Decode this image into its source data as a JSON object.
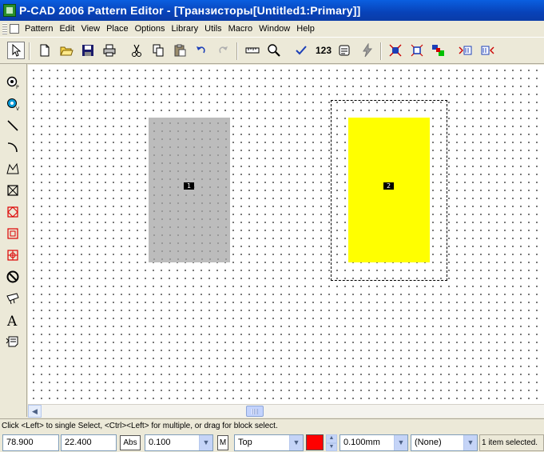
{
  "window": {
    "title": "P-CAD 2006 Pattern Editor - [Транзисторы[Untitled1:Primary]]"
  },
  "menu": {
    "items": [
      {
        "label": "Pattern"
      },
      {
        "label": "Edit"
      },
      {
        "label": "View"
      },
      {
        "label": "Place"
      },
      {
        "label": "Options"
      },
      {
        "label": "Library"
      },
      {
        "label": "Utils"
      },
      {
        "label": "Macro"
      },
      {
        "label": "Window"
      },
      {
        "label": "Help"
      }
    ]
  },
  "toolbar": {
    "buttons": [
      {
        "icon": "select-arrow-icon",
        "pressed": true
      },
      {
        "icon": "new-file-icon"
      },
      {
        "icon": "open-folder-icon"
      },
      {
        "icon": "save-icon"
      },
      {
        "icon": "print-icon"
      },
      {
        "icon": "cut-icon"
      },
      {
        "icon": "copy-icon"
      },
      {
        "icon": "paste-icon"
      },
      {
        "icon": "undo-icon"
      },
      {
        "icon": "redo-icon"
      },
      {
        "icon": "measure-ruler-icon"
      },
      {
        "icon": "zoom-icon"
      },
      {
        "icon": "check-icon"
      },
      {
        "icon": "renumber-icon",
        "text": "123"
      },
      {
        "icon": "pattern-wizard-icon"
      },
      {
        "icon": "lightning-icon"
      },
      {
        "icon": "pad-style-icon"
      },
      {
        "icon": "pad-array-icon"
      },
      {
        "icon": "component-icon"
      },
      {
        "icon": "pins-left-icon"
      },
      {
        "icon": "pins-right-icon"
      }
    ]
  },
  "left_tools": [
    {
      "icon": "place-pad-icon"
    },
    {
      "icon": "place-via-icon"
    },
    {
      "icon": "place-line-icon"
    },
    {
      "icon": "place-arc-icon"
    },
    {
      "icon": "place-polygon-icon"
    },
    {
      "icon": "place-cross-box-icon"
    },
    {
      "icon": "place-keepout-icon"
    },
    {
      "icon": "place-copper-pour-icon"
    },
    {
      "icon": "place-cutout-icon"
    },
    {
      "icon": "place-prohibit-icon"
    },
    {
      "icon": "place-attribute-icon"
    },
    {
      "icon": "place-text-icon"
    },
    {
      "icon": "place-field-icon"
    }
  ],
  "canvas": {
    "pads": [
      {
        "number": "1",
        "color": "#bcbcbc",
        "selected": false
      },
      {
        "number": "2",
        "color": "#ffff00",
        "selected": true
      }
    ]
  },
  "status_line": "Click <Left> to single Select, <Ctrl><Left> for multiple, or drag for block select.",
  "status_bar": {
    "x": "78.900",
    "y": "22.400",
    "abs_label": "Abs",
    "grid": "0.100",
    "m_label": "M",
    "layer": "Top",
    "layer_color": "#ff0000",
    "line_width": "0.100mm",
    "net": "(None)",
    "selection": "1 item selected."
  }
}
